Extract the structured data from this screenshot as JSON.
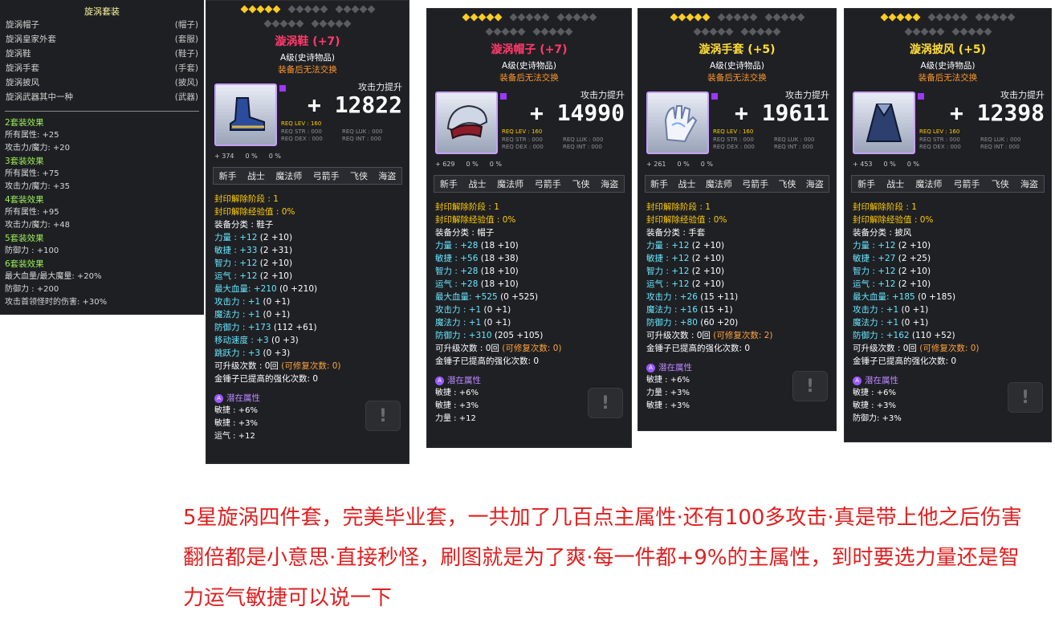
{
  "set": {
    "title": "旋涡套装",
    "items": [
      {
        "name": "旋涡帽子",
        "slot": "(帽子)"
      },
      {
        "name": "旋涡皇家外套",
        "slot": "(套服)"
      },
      {
        "name": "旋涡鞋",
        "slot": "(鞋子)"
      },
      {
        "name": "旋涡手套",
        "slot": "(手套)"
      },
      {
        "name": "旋涡披风",
        "slot": "(披风)"
      },
      {
        "name": "旋涡武器其中一种",
        "slot": "(武器)"
      }
    ],
    "effects": [
      {
        "title": "2套装效果",
        "lines": [
          "所有属性: +25",
          "攻击力/魔力: +20"
        ]
      },
      {
        "title": "3套装效果",
        "lines": [
          "所有属性: +75",
          "攻击力/魔力: +35"
        ]
      },
      {
        "title": "4套装效果",
        "lines": [
          "所有属性: +95",
          "攻击力/魔力: +48"
        ]
      },
      {
        "title": "5套装效果",
        "lines": [
          "防御力 : +100"
        ]
      },
      {
        "title": "6套装效果",
        "lines": [
          "最大血量/最大魔量: +20%",
          "防御力 : +200",
          "攻击首领怪时的伤害: +30%"
        ]
      }
    ]
  },
  "common": {
    "grade": "A级(史诗物品)",
    "trade": "装备后无法交换",
    "atk_label": "攻击力提升",
    "req_lev": "REQ LEV : 160",
    "req_str": "REQ STR : 000",
    "req_luk": "REQ LUK : 000",
    "req_dex": "REQ DEX : 000",
    "req_int": "REQ INT : 000",
    "jobs": [
      "新手",
      "战士",
      "魔法师",
      "弓箭手",
      "飞侠",
      "海盗"
    ],
    "pot_title": "潜在属性",
    "pot_badge": "A",
    "lock_glyph": "!",
    "colors": {
      "star_on": "#ffcc22",
      "star_off": "#5b5c62",
      "stat_blue": "#66e6ff",
      "seal_yellow": "#ffcc00"
    }
  },
  "cards": [
    {
      "name": "漩涡鞋 (+7)",
      "name_color": "#ff3a6a",
      "stars": 5,
      "atk": "+ 12822",
      "icon": "shoes-icon",
      "sub": [
        "+ 374",
        "0 %",
        "0 %"
      ],
      "stats": [
        [
          [
            "封印解除阶段 : 1",
            "y"
          ]
        ],
        [
          [
            "封印解除经验值 : 0%",
            "y"
          ]
        ],
        [
          [
            "装备分类 : 鞋子",
            "w"
          ]
        ],
        [
          [
            "力量 : +12 ",
            "b"
          ],
          [
            "(2 +10)",
            "w"
          ]
        ],
        [
          [
            "敏捷 : +33 ",
            "b"
          ],
          [
            "(2 +31)",
            "w"
          ]
        ],
        [
          [
            "智力 : +12 ",
            "b"
          ],
          [
            "(2 +10)",
            "w"
          ]
        ],
        [
          [
            "运气 : +12 ",
            "b"
          ],
          [
            "(2 +10)",
            "w"
          ]
        ],
        [
          [
            "最大血量: +210 ",
            "b"
          ],
          [
            "(0 +210)",
            "w"
          ]
        ],
        [
          [
            "攻击力 : +1 ",
            "b"
          ],
          [
            "(0 +1)",
            "w"
          ]
        ],
        [
          [
            "魔法力 : +1 ",
            "b"
          ],
          [
            "(0 +1)",
            "w"
          ]
        ],
        [
          [
            "防御力 : +173 ",
            "b"
          ],
          [
            "(112 +61)",
            "w"
          ]
        ],
        [
          [
            "移动速度 : +3 ",
            "b"
          ],
          [
            "(0 +3)",
            "w"
          ]
        ],
        [
          [
            "跳跃力 : +3 ",
            "b"
          ],
          [
            "(0 +3)",
            "w"
          ]
        ],
        [
          [
            "可升级次数 : 0回 ",
            "w"
          ],
          [
            "(可修复次数: 0)",
            "o"
          ]
        ],
        [
          [
            "金锤子已提高的强化次数: 0",
            "w"
          ]
        ]
      ],
      "pot": [
        "敏捷 : +6%",
        "敏捷 : +3%",
        "运气 : +12"
      ]
    },
    {
      "name": "漩涡帽子 (+7)",
      "name_color": "#ff3a6a",
      "stars": 5,
      "atk": "+ 14990",
      "icon": "hat-icon",
      "sub": [
        "+ 629",
        "0 %",
        "0 %"
      ],
      "stats": [
        [
          [
            "封印解除阶段 : 1",
            "y"
          ]
        ],
        [
          [
            "封印解除经验值 : 0%",
            "y"
          ]
        ],
        [
          [
            "装备分类 : 帽子",
            "w"
          ]
        ],
        [
          [
            "力量 : +28 ",
            "b"
          ],
          [
            "(18 +10)",
            "w"
          ]
        ],
        [
          [
            "敏捷 : +56 ",
            "b"
          ],
          [
            "(18 +38)",
            "w"
          ]
        ],
        [
          [
            "智力 : +28 ",
            "b"
          ],
          [
            "(18 +10)",
            "w"
          ]
        ],
        [
          [
            "运气 : +28 ",
            "b"
          ],
          [
            "(18 +10)",
            "w"
          ]
        ],
        [
          [
            "最大血量: +525 ",
            "b"
          ],
          [
            "(0 +525)",
            "w"
          ]
        ],
        [
          [
            "攻击力 : +1 ",
            "b"
          ],
          [
            "(0 +1)",
            "w"
          ]
        ],
        [
          [
            "魔法力 : +1 ",
            "b"
          ],
          [
            "(0 +1)",
            "w"
          ]
        ],
        [
          [
            "防御力 : +310 ",
            "b"
          ],
          [
            "(205 +105)",
            "w"
          ]
        ],
        [
          [
            "可升级次数 : 0回 ",
            "w"
          ],
          [
            "(可修复次数: 0)",
            "o"
          ]
        ],
        [
          [
            "金锤子已提高的强化次数: 0",
            "w"
          ]
        ]
      ],
      "pot": [
        "敏捷 : +6%",
        "敏捷 : +3%",
        "力量 : +12"
      ]
    },
    {
      "name": "漩涡手套 (+5)",
      "name_color": "#ffdd33",
      "stars": 5,
      "atk": "+ 19611",
      "icon": "glove-icon",
      "sub": [
        "+ 261",
        "0 %",
        "0 %"
      ],
      "stats": [
        [
          [
            "封印解除阶段 : 1",
            "y"
          ]
        ],
        [
          [
            "封印解除经验值 : 0%",
            "y"
          ]
        ],
        [
          [
            "装备分类 : 手套",
            "w"
          ]
        ],
        [
          [
            "力量 : +12 ",
            "b"
          ],
          [
            "(2 +10)",
            "w"
          ]
        ],
        [
          [
            "敏捷 : +12 ",
            "b"
          ],
          [
            "(2 +10)",
            "w"
          ]
        ],
        [
          [
            "智力 : +12 ",
            "b"
          ],
          [
            "(2 +10)",
            "w"
          ]
        ],
        [
          [
            "运气 : +12 ",
            "b"
          ],
          [
            "(2 +10)",
            "w"
          ]
        ],
        [
          [
            "攻击力 : +26 ",
            "b"
          ],
          [
            "(15 +11)",
            "w"
          ]
        ],
        [
          [
            "魔法力 : +16 ",
            "b"
          ],
          [
            "(15 +1)",
            "w"
          ]
        ],
        [
          [
            "防御力 : +80 ",
            "b"
          ],
          [
            "(60 +20)",
            "w"
          ]
        ],
        [
          [
            "可升级次数 : 0回 ",
            "w"
          ],
          [
            "(可修复次数: 2)",
            "o"
          ]
        ],
        [
          [
            "金锤子已提高的强化次数: 0",
            "w"
          ]
        ]
      ],
      "pot": [
        "敏捷 : +6%",
        "力量 : +3%",
        "敏捷 : +3%"
      ]
    },
    {
      "name": "漩涡披风 (+5)",
      "name_color": "#ffdd33",
      "stars": 5,
      "atk": "+ 12398",
      "icon": "cape-icon",
      "sub": [
        "+ 453",
        "0 %",
        "0 %"
      ],
      "stats": [
        [
          [
            "封印解除阶段 : 1",
            "y"
          ]
        ],
        [
          [
            "封印解除经验值 : 0%",
            "y"
          ]
        ],
        [
          [
            "装备分类 : 披风",
            "w"
          ]
        ],
        [
          [
            "力量 : +12 ",
            "b"
          ],
          [
            "(2 +10)",
            "w"
          ]
        ],
        [
          [
            "敏捷 : +27 ",
            "b"
          ],
          [
            "(2 +25)",
            "w"
          ]
        ],
        [
          [
            "智力 : +12 ",
            "b"
          ],
          [
            "(2 +10)",
            "w"
          ]
        ],
        [
          [
            "运气 : +12 ",
            "b"
          ],
          [
            "(2 +10)",
            "w"
          ]
        ],
        [
          [
            "最大血量: +185 ",
            "b"
          ],
          [
            "(0 +185)",
            "w"
          ]
        ],
        [
          [
            "攻击力 : +1 ",
            "b"
          ],
          [
            "(0 +1)",
            "w"
          ]
        ],
        [
          [
            "魔法力 : +1 ",
            "b"
          ],
          [
            "(0 +1)",
            "w"
          ]
        ],
        [
          [
            "防御力 : +162 ",
            "b"
          ],
          [
            "(110 +52)",
            "w"
          ]
        ],
        [
          [
            "可升级次数 : 0回 ",
            "w"
          ],
          [
            "(可修复次数: 0)",
            "o"
          ]
        ],
        [
          [
            "金锤子已提高的强化次数: 0",
            "w"
          ]
        ]
      ],
      "pot": [
        "敏捷 : +6%",
        "敏捷 : +3%",
        "防御力: +3%"
      ]
    }
  ],
  "caption": "5星旋涡四件套，完美毕业套，一共加了几百点主属性·还有100多攻击·真是带上他之后伤害翻倍都是小意思·直接秒怪，刷图就是为了爽·每一件都+9%的主属性，到时要选力量还是智力运气敏捷可以说一下"
}
